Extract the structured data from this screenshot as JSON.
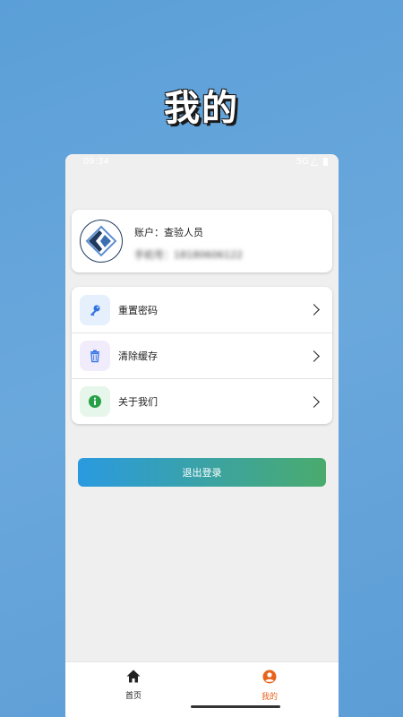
{
  "headline": "我的",
  "status_bar": {
    "time": "09:34",
    "network": "5G"
  },
  "profile": {
    "account_prefix": "账户：",
    "account_name": "查验人员",
    "phone_prefix": "手机号：",
    "phone_number": "18180606122"
  },
  "menu": {
    "items": [
      {
        "label": "重置密码",
        "icon": "key-icon",
        "bg": "#e6f0fd",
        "color": "#2f6fe0"
      },
      {
        "label": "清除缓存",
        "icon": "trash-icon",
        "bg": "#f1ecfb",
        "color": "#3b78e6"
      },
      {
        "label": "关于我们",
        "icon": "info-icon",
        "bg": "#e7f6ea",
        "color": "#27a046"
      }
    ]
  },
  "logout": {
    "label": "退出登录",
    "gradient_start": "#2a9ae0",
    "gradient_end": "#4aab6d"
  },
  "tabbar": {
    "tabs": [
      {
        "label": "首页",
        "icon": "home-icon",
        "active": false
      },
      {
        "label": "我的",
        "icon": "user-icon",
        "active": true
      }
    ],
    "active_color": "#e8641c"
  }
}
